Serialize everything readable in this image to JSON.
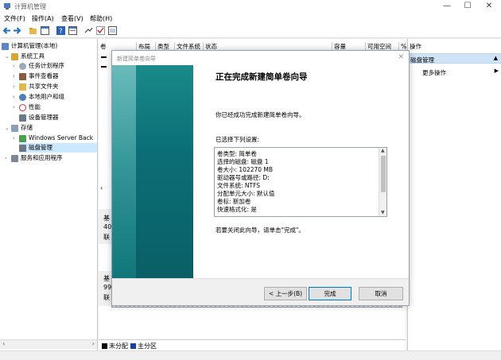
{
  "window": {
    "title": "计算机管理",
    "minimize": "—",
    "maximize": "☐",
    "close": "✕"
  },
  "menu": [
    "文件(F)",
    "操作(A)",
    "查看(V)",
    "帮助(H)"
  ],
  "tree": {
    "root": "计算机管理(本地)",
    "system_tools": "系统工具",
    "task_scheduler": "任务计划程序",
    "event_viewer": "事件查看器",
    "shared_folders": "共享文件夹",
    "local_users": "本地用户和组",
    "performance": "性能",
    "device_manager": "设备管理器",
    "storage": "存储",
    "windows_server_backup": "Windows Server Back",
    "disk_management": "磁盘管理",
    "services_apps": "服务和应用程序"
  },
  "columns": [
    "卷",
    "布局",
    "类型",
    "文件系统",
    "状态",
    "容量",
    "可用空间",
    "%"
  ],
  "center_fragments": {
    "disk0_a": "基",
    "disk0_b": "40",
    "disk0_c": "联",
    "disk1_a": "基",
    "disk1_b": "99",
    "disk1_c": "联"
  },
  "actions": {
    "header": "操作",
    "section": "磁盘管理",
    "more": "更多操作"
  },
  "legend": {
    "unallocated": "未分配",
    "primary": "主分区"
  },
  "dialog": {
    "title": "新建简单卷向导",
    "heading": "正在完成新建简单卷向导",
    "intro": "你已经成功完成新建简单卷向导。",
    "selected_label": "已选择下列设置:",
    "settings": [
      "卷类型: 简单卷",
      "选择的磁盘: 磁盘 1",
      "卷大小: 102270 MB",
      "驱动器号或路径: D:",
      "文件系统: NTFS",
      "分配单元大小: 默认值",
      "卷标: 新加卷",
      "快速格式化: 是"
    ],
    "close_hint": "若要关闭此向导，请单击\"完成\"。",
    "back_button": "< 上一步(B)",
    "finish_button": "完成",
    "cancel_button": "取消"
  },
  "colors": {
    "accent": "#0078d7",
    "selection": "#cce8ff",
    "wizard_teal": "#0b6f77",
    "legend_black": "#000000",
    "legend_blue": "#1a3fa8"
  }
}
